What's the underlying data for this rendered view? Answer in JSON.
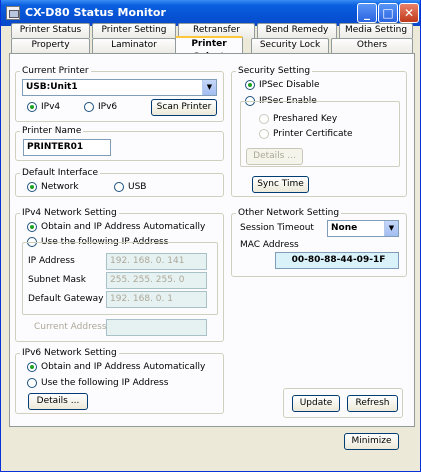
{
  "window": {
    "title": "CX-D80 Status Monitor"
  },
  "tabs_row1": [
    "Printer Status",
    "Printer Setting",
    "Retransfer",
    "Bend Remedy",
    "Media Setting"
  ],
  "tabs_row2": [
    "Property",
    "Laminator",
    "Printer Select",
    "Security Lock",
    "Others"
  ],
  "current_printer": {
    "legend": "Current Printer",
    "selected": "USB:Unit1",
    "ipv4_label": "IPv4",
    "ipv6_label": "IPv6",
    "scan_button": "Scan Printer"
  },
  "printer_name": {
    "legend": "Printer Name",
    "value": "PRINTER01"
  },
  "default_interface": {
    "legend": "Default Interface",
    "network_label": "Network",
    "usb_label": "USB"
  },
  "ipv4": {
    "legend": "IPv4 Network Setting",
    "auto_label": "Obtain and IP Address Automatically",
    "manual_label": "Use the following IP Address",
    "ip_label": "IP Address",
    "ip_value": "192. 168. 0. 141",
    "mask_label": "Subnet Mask",
    "mask_value": "255. 255. 255. 0",
    "gateway_label": "Default Gateway",
    "gateway_value": "192. 168. 0. 1",
    "current_label": "Current Address",
    "current_value": ""
  },
  "ipv6": {
    "legend": "IPv6 Network Setting",
    "auto_label": "Obtain and IP Address Automatically",
    "manual_label": "Use the following IP Address",
    "details_button": "Details ..."
  },
  "security": {
    "legend": "Security Setting",
    "disable_label": "IPSec Disable",
    "enable_label": "IPSec Enable",
    "preshared_label": "Preshared Key",
    "certificate_label": "Printer Certificate",
    "details_button": "Details ...",
    "sync_button": "Sync Time"
  },
  "other_network": {
    "legend": "Other Network Setting",
    "timeout_label": "Session Timeout",
    "timeout_value": "None",
    "mac_label": "MAC Address",
    "mac_value": "00-80-88-44-09-1F"
  },
  "actions": {
    "update": "Update",
    "refresh": "Refresh",
    "minimize": "Minimize"
  },
  "colors": {
    "title_bar": "#0653d4",
    "active_tab_accent": "#ffc83c",
    "mac_bg": "#d9f2fa"
  }
}
